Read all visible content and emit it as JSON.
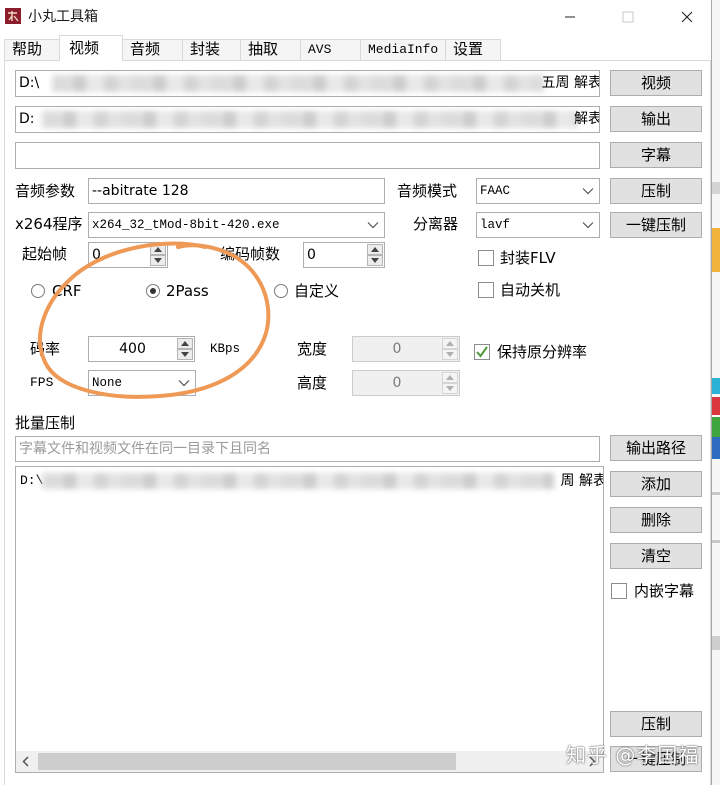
{
  "title_bar": {
    "title": "小丸工具箱",
    "icons": {
      "app": "app-icon",
      "minimize": "minimize-icon",
      "maximize": "maximize-icon",
      "close": "close-icon"
    }
  },
  "tabs": [
    {
      "label": "帮助",
      "selected": false
    },
    {
      "label": "视频",
      "selected": true
    },
    {
      "label": "音频",
      "selected": false
    },
    {
      "label": "封装",
      "selected": false
    },
    {
      "label": "抽取",
      "selected": false
    },
    {
      "label": "AVS",
      "selected": false
    },
    {
      "label": "MediaInfo",
      "selected": false
    },
    {
      "label": "设置",
      "selected": false
    }
  ],
  "video": {
    "input_file": {
      "start": "D:\\",
      "end": "五周 解表"
    },
    "output_file": {
      "start": "D:",
      "end": "解表"
    },
    "subtitle_file": "",
    "buttons": {
      "video": "视频",
      "output": "输出",
      "subtitle": "字幕",
      "encode": "压制",
      "one_click_encode": "一键压制"
    },
    "audio_params": {
      "label": "音频参数",
      "value": "--abitrate 128"
    },
    "audio_mode": {
      "label": "音频模式",
      "value": "FAAC"
    },
    "x264_program": {
      "label": "x264程序",
      "value": "x264_32_tMod-8bit-420.exe"
    },
    "splitter": {
      "label": "分离器",
      "value": "lavf"
    },
    "start_frame": {
      "label": "起始帧",
      "value": "0"
    },
    "frame_count": {
      "label": "编码帧数",
      "value": "0"
    },
    "rate_mode": [
      {
        "label": "CRF",
        "selected": false
      },
      {
        "label": "2Pass",
        "selected": true
      },
      {
        "label": "自定义",
        "selected": false
      }
    ],
    "bitrate": {
      "label": "码率",
      "value": "400",
      "unit": "KBps"
    },
    "fps": {
      "label": "FPS",
      "value": "None"
    },
    "width": {
      "label": "宽度",
      "value": "0",
      "enabled": false
    },
    "height": {
      "label": "高度",
      "value": "0",
      "enabled": false
    },
    "pack_flv": {
      "label": "封装FLV",
      "checked": false
    },
    "auto_shutdown": {
      "label": "自动关机",
      "checked": false
    },
    "keep_resolution": {
      "label": "保持原分辨率",
      "checked": true
    }
  },
  "batch": {
    "title": "批量压制",
    "placeholder": "字幕文件和视频文件在同一目录下且同名",
    "files": [
      {
        "start": "D:\\",
        "end": "周 解表"
      }
    ],
    "buttons": {
      "output_path": "输出路径",
      "add": "添加",
      "remove": "删除",
      "clear": "清空",
      "encode": "压制",
      "one_click_encode": "一键压制"
    },
    "embed_subtitle": {
      "label": "内嵌字幕",
      "checked": false
    }
  },
  "annotation_color": "#EE9A56",
  "watermark": "知乎 @李国福"
}
